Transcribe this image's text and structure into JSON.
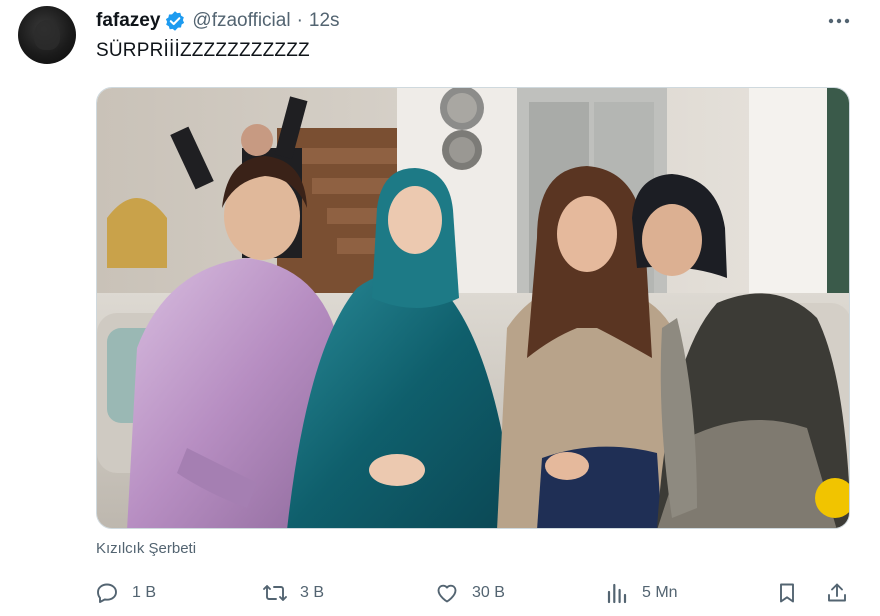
{
  "tweet": {
    "display_name": "fafazey",
    "handle": "@fzaofficial",
    "separator": "·",
    "time": "12s",
    "text": "SÜRPRİİİZZZZZZZZZZZ",
    "media_caption": "Kızılcık Şerbeti"
  },
  "actions": {
    "reply": {
      "icon": "reply-icon",
      "count": "1 B"
    },
    "retweet": {
      "icon": "retweet-icon",
      "count": "3 B"
    },
    "like": {
      "icon": "heart-icon",
      "count": "30 B"
    },
    "views": {
      "icon": "analytics-icon",
      "count": "5 Mn"
    },
    "bookmark": {
      "icon": "bookmark-icon"
    },
    "share": {
      "icon": "share-icon"
    }
  },
  "colors": {
    "text": "#0f1419",
    "muted": "#536471",
    "verified": "#1d9bf0",
    "border": "#cfd9de"
  }
}
